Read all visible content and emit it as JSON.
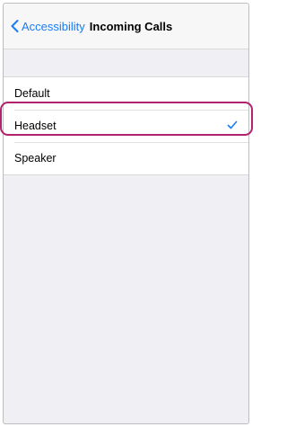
{
  "nav": {
    "back_label": "Accessibility",
    "title": "Incoming Calls"
  },
  "options": [
    {
      "label": "Default",
      "selected": false
    },
    {
      "label": "Headset",
      "selected": true
    },
    {
      "label": "Speaker",
      "selected": false
    }
  ],
  "colors": {
    "accent": "#1a7cf5",
    "highlight": "#b0236f",
    "background": "#efeff4"
  },
  "icons": {
    "back": "chevron-left-icon",
    "selected": "checkmark-icon"
  }
}
